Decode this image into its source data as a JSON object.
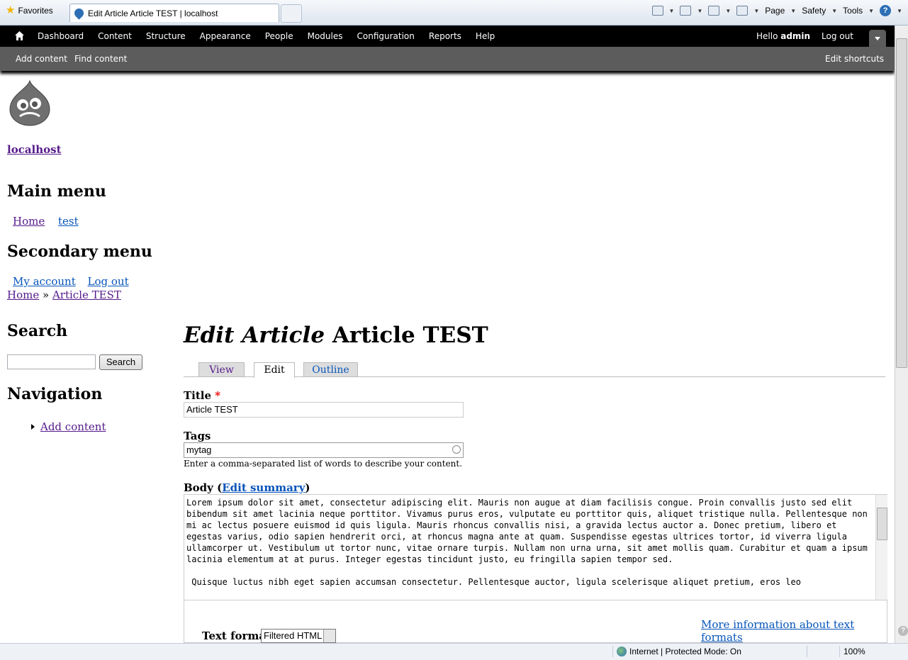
{
  "browser": {
    "favorites": "Favorites",
    "tab_title": "Edit Article Article TEST | localhost",
    "commands": [
      "Page",
      "Safety",
      "Tools"
    ],
    "status_zone": "Internet | Protected Mode: On",
    "zoom": "100%"
  },
  "toolbar": {
    "items": [
      "Dashboard",
      "Content",
      "Structure",
      "Appearance",
      "People",
      "Modules",
      "Configuration",
      "Reports",
      "Help"
    ],
    "hello_prefix": "Hello ",
    "user": "admin",
    "logout": "Log out",
    "shortcuts": [
      "Add content",
      "Find content"
    ],
    "edit_shortcuts": "Edit shortcuts"
  },
  "site": {
    "name": "localhost",
    "main_menu_title": "Main menu",
    "main_menu": [
      "Home",
      "test"
    ],
    "secondary_menu_title": "Secondary menu",
    "secondary_menu": [
      "My account",
      "Log out"
    ],
    "breadcrumb": [
      "Home",
      "Article TEST"
    ],
    "breadcrumb_sep": "»"
  },
  "sidebar": {
    "search_title": "Search",
    "search_button": "Search",
    "navigation_title": "Navigation",
    "nav_items": [
      "Add content"
    ]
  },
  "page": {
    "title_em": "Edit Article",
    "title_rest": " Article TEST",
    "tabs": [
      "View",
      "Edit",
      "Outline"
    ],
    "title_label": "Title",
    "required_mark": "*",
    "title_value": "Article TEST",
    "tags_label": "Tags",
    "tags_value": "mytag",
    "tags_desc": "Enter a comma-separated list of words to describe your content.",
    "body_label": "Body",
    "edit_summary": "Edit summary",
    "body_text": "Lorem ipsum dolor sit amet, consectetur adipiscing elit. Mauris non augue at diam facilisis congue. Proin convallis justo sed elit bibendum sit amet lacinia neque porttitor. Vivamus purus eros, vulputate eu porttitor quis, aliquet tristique nulla. Pellentesque non mi ac lectus posuere euismod id quis ligula. Mauris rhoncus convallis nisi, a gravida lectus auctor a. Donec pretium, libero et egestas varius, odio sapien hendrerit orci, at rhoncus magna ante at quam. Suspendisse egestas ultrices tortor, id viverra ligula ullamcorper ut. Vestibulum ut tortor nunc, vitae ornare turpis. Nullam non urna urna, sit amet mollis quam. Curabitur et quam a ipsum lacinia elementum at at purus. Integer egestas tincidunt justo, eu fringilla sapien tempor sed.\n\n Quisque luctus nibh eget sapien accumsan consectetur. Pellentesque auctor, ligula scelerisque aliquet pretium, eros leo",
    "more_info": "More information about text formats",
    "text_format_label": "Text format",
    "text_format_value": "Filtered HTML"
  }
}
